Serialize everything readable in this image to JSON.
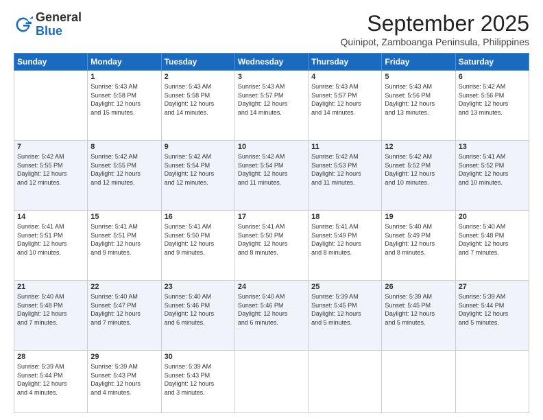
{
  "logo": {
    "general": "General",
    "blue": "Blue"
  },
  "title": "September 2025",
  "subtitle": "Quinipot, Zamboanga Peninsula, Philippines",
  "days_of_week": [
    "Sunday",
    "Monday",
    "Tuesday",
    "Wednesday",
    "Thursday",
    "Friday",
    "Saturday"
  ],
  "weeks": [
    [
      {
        "day": "",
        "info": ""
      },
      {
        "day": "1",
        "info": "Sunrise: 5:43 AM\nSunset: 5:58 PM\nDaylight: 12 hours\nand 15 minutes."
      },
      {
        "day": "2",
        "info": "Sunrise: 5:43 AM\nSunset: 5:58 PM\nDaylight: 12 hours\nand 14 minutes."
      },
      {
        "day": "3",
        "info": "Sunrise: 5:43 AM\nSunset: 5:57 PM\nDaylight: 12 hours\nand 14 minutes."
      },
      {
        "day": "4",
        "info": "Sunrise: 5:43 AM\nSunset: 5:57 PM\nDaylight: 12 hours\nand 14 minutes."
      },
      {
        "day": "5",
        "info": "Sunrise: 5:43 AM\nSunset: 5:56 PM\nDaylight: 12 hours\nand 13 minutes."
      },
      {
        "day": "6",
        "info": "Sunrise: 5:42 AM\nSunset: 5:56 PM\nDaylight: 12 hours\nand 13 minutes."
      }
    ],
    [
      {
        "day": "7",
        "info": "Sunrise: 5:42 AM\nSunset: 5:55 PM\nDaylight: 12 hours\nand 12 minutes."
      },
      {
        "day": "8",
        "info": "Sunrise: 5:42 AM\nSunset: 5:55 PM\nDaylight: 12 hours\nand 12 minutes."
      },
      {
        "day": "9",
        "info": "Sunrise: 5:42 AM\nSunset: 5:54 PM\nDaylight: 12 hours\nand 12 minutes."
      },
      {
        "day": "10",
        "info": "Sunrise: 5:42 AM\nSunset: 5:54 PM\nDaylight: 12 hours\nand 11 minutes."
      },
      {
        "day": "11",
        "info": "Sunrise: 5:42 AM\nSunset: 5:53 PM\nDaylight: 12 hours\nand 11 minutes."
      },
      {
        "day": "12",
        "info": "Sunrise: 5:42 AM\nSunset: 5:52 PM\nDaylight: 12 hours\nand 10 minutes."
      },
      {
        "day": "13",
        "info": "Sunrise: 5:41 AM\nSunset: 5:52 PM\nDaylight: 12 hours\nand 10 minutes."
      }
    ],
    [
      {
        "day": "14",
        "info": "Sunrise: 5:41 AM\nSunset: 5:51 PM\nDaylight: 12 hours\nand 10 minutes."
      },
      {
        "day": "15",
        "info": "Sunrise: 5:41 AM\nSunset: 5:51 PM\nDaylight: 12 hours\nand 9 minutes."
      },
      {
        "day": "16",
        "info": "Sunrise: 5:41 AM\nSunset: 5:50 PM\nDaylight: 12 hours\nand 9 minutes."
      },
      {
        "day": "17",
        "info": "Sunrise: 5:41 AM\nSunset: 5:50 PM\nDaylight: 12 hours\nand 8 minutes."
      },
      {
        "day": "18",
        "info": "Sunrise: 5:41 AM\nSunset: 5:49 PM\nDaylight: 12 hours\nand 8 minutes."
      },
      {
        "day": "19",
        "info": "Sunrise: 5:40 AM\nSunset: 5:49 PM\nDaylight: 12 hours\nand 8 minutes."
      },
      {
        "day": "20",
        "info": "Sunrise: 5:40 AM\nSunset: 5:48 PM\nDaylight: 12 hours\nand 7 minutes."
      }
    ],
    [
      {
        "day": "21",
        "info": "Sunrise: 5:40 AM\nSunset: 5:48 PM\nDaylight: 12 hours\nand 7 minutes."
      },
      {
        "day": "22",
        "info": "Sunrise: 5:40 AM\nSunset: 5:47 PM\nDaylight: 12 hours\nand 7 minutes."
      },
      {
        "day": "23",
        "info": "Sunrise: 5:40 AM\nSunset: 5:46 PM\nDaylight: 12 hours\nand 6 minutes."
      },
      {
        "day": "24",
        "info": "Sunrise: 5:40 AM\nSunset: 5:46 PM\nDaylight: 12 hours\nand 6 minutes."
      },
      {
        "day": "25",
        "info": "Sunrise: 5:39 AM\nSunset: 5:45 PM\nDaylight: 12 hours\nand 5 minutes."
      },
      {
        "day": "26",
        "info": "Sunrise: 5:39 AM\nSunset: 5:45 PM\nDaylight: 12 hours\nand 5 minutes."
      },
      {
        "day": "27",
        "info": "Sunrise: 5:39 AM\nSunset: 5:44 PM\nDaylight: 12 hours\nand 5 minutes."
      }
    ],
    [
      {
        "day": "28",
        "info": "Sunrise: 5:39 AM\nSunset: 5:44 PM\nDaylight: 12 hours\nand 4 minutes."
      },
      {
        "day": "29",
        "info": "Sunrise: 5:39 AM\nSunset: 5:43 PM\nDaylight: 12 hours\nand 4 minutes."
      },
      {
        "day": "30",
        "info": "Sunrise: 5:39 AM\nSunset: 5:43 PM\nDaylight: 12 hours\nand 3 minutes."
      },
      {
        "day": "",
        "info": ""
      },
      {
        "day": "",
        "info": ""
      },
      {
        "day": "",
        "info": ""
      },
      {
        "day": "",
        "info": ""
      }
    ]
  ]
}
